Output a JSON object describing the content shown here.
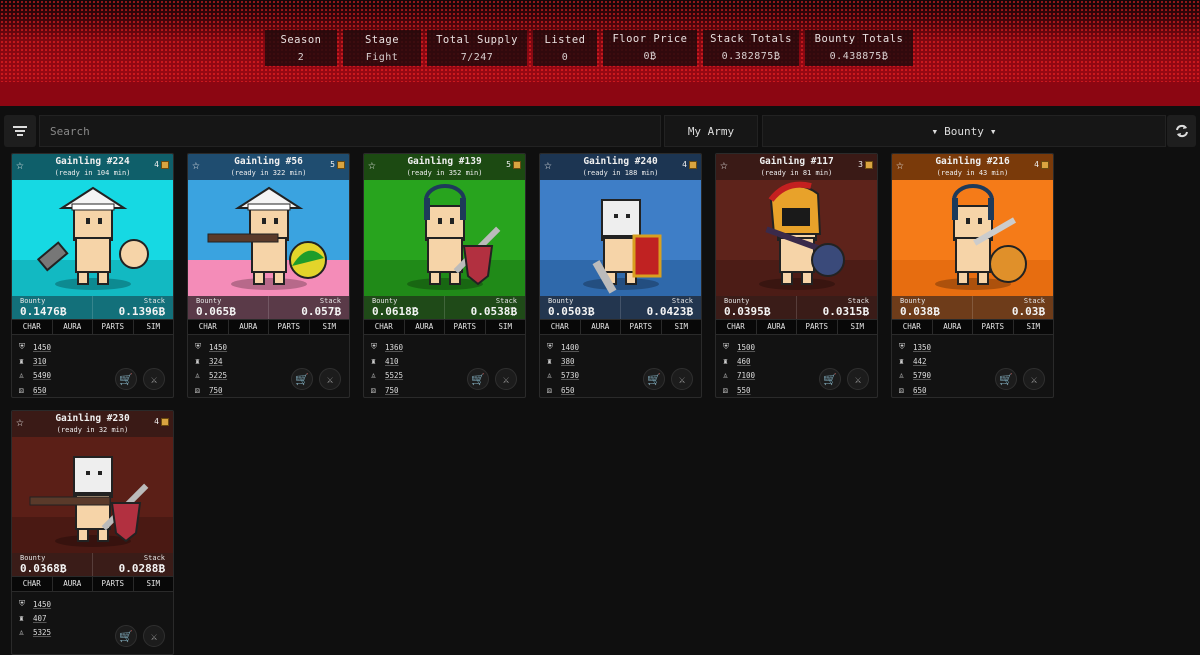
{
  "stats": [
    {
      "label": "Season",
      "value": "2"
    },
    {
      "label": "Stage",
      "value": "Fight"
    },
    {
      "label": "Total Supply",
      "value": "7/247"
    },
    {
      "label": "Listed",
      "value": "0"
    },
    {
      "label": "Floor Price",
      "value": "0₿"
    },
    {
      "label": "Stack Totals",
      "value": "0.382875₿"
    },
    {
      "label": "Bounty Totals",
      "value": "0.438875₿"
    }
  ],
  "toolbar": {
    "search_placeholder": "Search",
    "army_label": "My Army",
    "sort_label": "Bounty"
  },
  "card_labels": {
    "bounty": "Bounty",
    "stack": "Stack",
    "tabs": [
      "CHAR",
      "AURA",
      "PARTS",
      "SIM"
    ]
  },
  "cards": [
    {
      "title": "Gainling #224",
      "ready": "(ready in 104 min)",
      "level": "4",
      "bounty": "0.1476₿",
      "stack": "0.1396₿",
      "attrs": [
        "1450",
        "310",
        "5490",
        "650"
      ],
      "bg": "cyan"
    },
    {
      "title": "Gainling #56",
      "ready": "(ready in 322 min)",
      "level": "5",
      "bounty": "0.065₿",
      "stack": "0.057₿",
      "attrs": [
        "1450",
        "324",
        "5225",
        "750"
      ],
      "bg": "bluepink"
    },
    {
      "title": "Gainling #139",
      "ready": "(ready in 352 min)",
      "level": "5",
      "bounty": "0.0618₿",
      "stack": "0.0538₿",
      "attrs": [
        "1360",
        "410",
        "5525",
        "750"
      ],
      "bg": "green"
    },
    {
      "title": "Gainling #240",
      "ready": "(ready in 188 min)",
      "level": "4",
      "bounty": "0.0503₿",
      "stack": "0.0423₿",
      "attrs": [
        "1400",
        "380",
        "5730",
        "650"
      ],
      "bg": "blue"
    },
    {
      "title": "Gainling #117",
      "ready": "(ready in 81 min)",
      "level": "3",
      "bounty": "0.0395₿",
      "stack": "0.0315₿",
      "attrs": [
        "1500",
        "460",
        "7100",
        "550"
      ],
      "bg": "darkred"
    },
    {
      "title": "Gainling #216",
      "ready": "(ready in 43 min)",
      "level": "4",
      "bounty": "0.038₿",
      "stack": "0.03₿",
      "attrs": [
        "1350",
        "442",
        "5790",
        "650"
      ],
      "bg": "orange"
    },
    {
      "title": "Gainling #230",
      "ready": "(ready in 32 min)",
      "level": "4",
      "bounty": "0.0368₿",
      "stack": "0.0288₿",
      "attrs": [
        "1450",
        "407",
        "5325",
        ""
      ],
      "bg": "maroon"
    }
  ],
  "colors": {
    "cyan": {
      "top": "#0f5f6a",
      "art": "#16d9e3",
      "floor": "#12b9c2",
      "money": "#13707a"
    },
    "bluepink": {
      "top": "#1f4d70",
      "art": "#3aa3e0",
      "floor": "#f48cb8",
      "money": "#5a3a48"
    },
    "green": {
      "top": "#1c4a12",
      "art": "#28a41e",
      "floor": "#208a18",
      "money": "#1f4a18"
    },
    "blue": {
      "top": "#1c3552",
      "art": "#3e7ec7",
      "floor": "#2f69ab",
      "money": "#23364f"
    },
    "darkred": {
      "top": "#3a1a16",
      "art": "#5e231b",
      "floor": "#4c1c16",
      "money": "#3a1c18"
    },
    "orange": {
      "top": "#7a3a0a",
      "art": "#f57b18",
      "floor": "#e76d10",
      "money": "#6e3c1a"
    },
    "maroon": {
      "top": "#3a1a16",
      "art": "#5b1f17",
      "floor": "#4a1913",
      "money": "#3a1c18"
    }
  }
}
